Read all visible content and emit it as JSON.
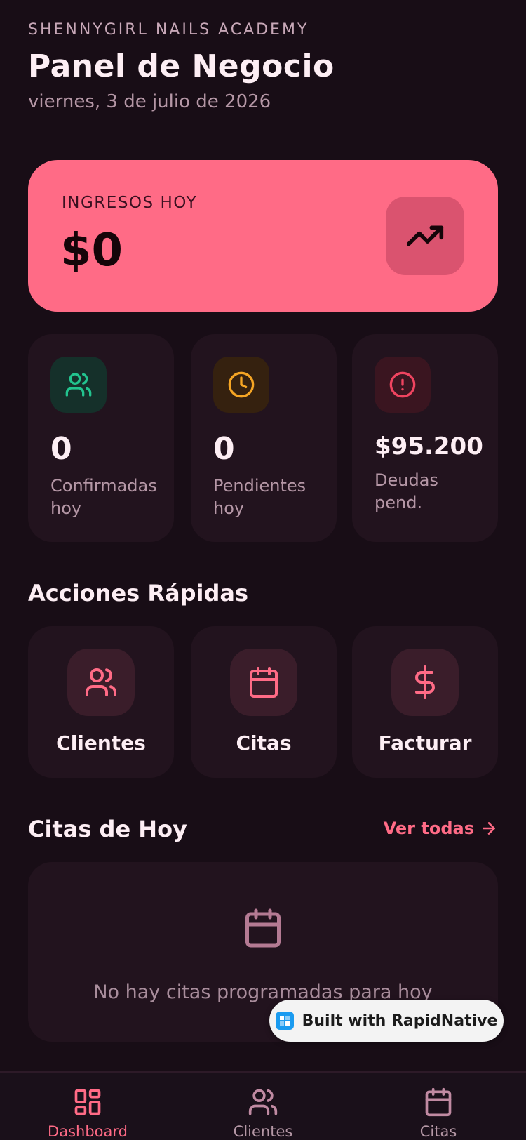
{
  "header": {
    "academy": "SHENNYGIRL NAILS ACADEMY",
    "title": "Panel de Negocio",
    "date": "viernes, 3 de julio de 2026"
  },
  "income": {
    "label": "INGRESOS HOY",
    "value": "$0",
    "icon": "trending-up-icon"
  },
  "stats": [
    {
      "value": "0",
      "label": "Confirmadas hoy",
      "icon": "users-icon",
      "color": "#22c38e"
    },
    {
      "value": "0",
      "label": "Pendientes hoy",
      "icon": "clock-icon",
      "color": "#f5a524"
    },
    {
      "value": "$95.200",
      "label": "Deudas pend.",
      "icon": "alert-circle-icon",
      "color": "#ef4460"
    }
  ],
  "quick_actions": {
    "title": "Acciones Rápidas",
    "items": [
      {
        "label": "Clientes",
        "icon": "users-icon"
      },
      {
        "label": "Citas",
        "icon": "calendar-icon"
      },
      {
        "label": "Facturar",
        "icon": "dollar-icon"
      }
    ]
  },
  "today_appointments": {
    "title": "Citas de Hoy",
    "see_all": "Ver todas",
    "empty_text": "No hay citas programadas para hoy"
  },
  "badge": {
    "text": "Built with RapidNative"
  },
  "bottom_nav": [
    {
      "label": "Dashboard",
      "icon": "dashboard-icon",
      "active": true
    },
    {
      "label": "Clientes",
      "icon": "users-icon",
      "active": false
    },
    {
      "label": "Citas",
      "icon": "calendar-icon",
      "active": false
    }
  ],
  "colors": {
    "background": "#180d16",
    "accent": "#ff6b86",
    "card": "#22131e"
  }
}
